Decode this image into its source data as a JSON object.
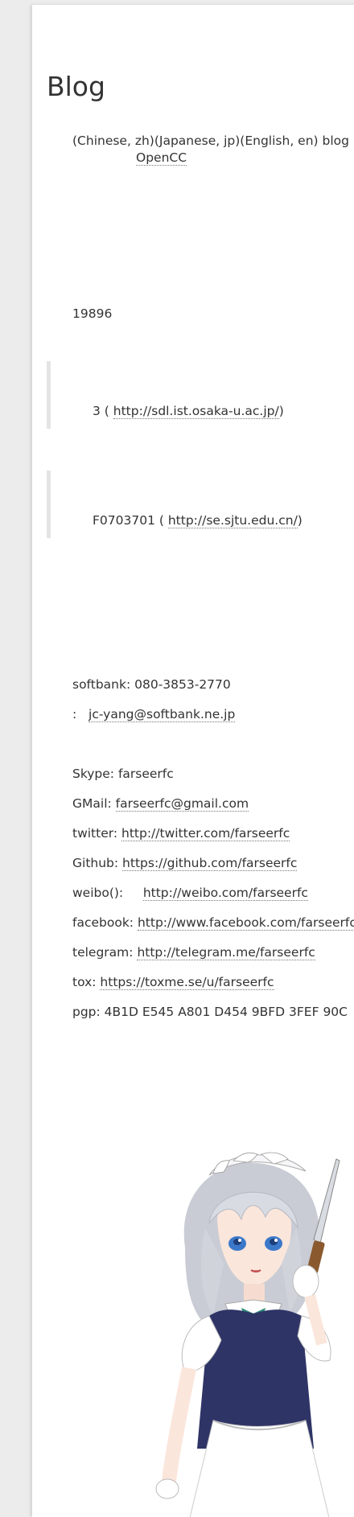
{
  "page": {
    "title": "Blog",
    "intro": "(Chinese, zh)(Japanese, jp)(English, en) blog",
    "opencc": "OpenCC",
    "year": "19896",
    "school1_prefix": "3 (",
    "school1_link": "http://sdl.ist.osaka-u.ac.jp/",
    "school1_suffix": ")",
    "school2_prefix": "F0703701 (",
    "school2_link": "http://se.sjtu.edu.cn/",
    "school2_suffix": ")"
  },
  "contact": {
    "softbank": "softbank: 080-3853-2770",
    "mail_prefix": ":",
    "mail": "jc-yang@softbank.ne.jp",
    "skype": "Skype: farseerfc",
    "gmail_label": "GMail:",
    "gmail": "farseerfc@gmail.com",
    "twitter_label": "twitter:",
    "twitter": "http://twitter.com/farseerfc",
    "github_label": "Github:",
    "github": "https://github.com/farseerfc",
    "weibo_label": "weibo():",
    "weibo": "http://weibo.com/farseerfc",
    "facebook_label": "facebook:",
    "facebook": "http://www.facebook.com/farseerfc",
    "telegram_label": "telegram:",
    "telegram": "http://telegram.me/farseerfc",
    "tox_label": "tox:",
    "tox": "https://toxme.se/u/farseerfc",
    "pgp": "pgp: 4B1D E545 A801 D454 9BFD 3FEF 90C"
  }
}
